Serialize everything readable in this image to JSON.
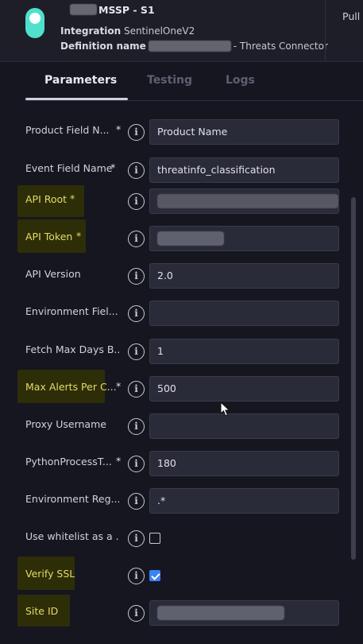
{
  "header": {
    "title": "MSSP - S1",
    "integration_label": "Integration",
    "integration_value": "SentinelOneV2",
    "definition_label": "Definition name",
    "definition_value": "- Threats Connector",
    "pull_label": "Pull"
  },
  "tabs": [
    {
      "label": "Parameters",
      "active": true
    },
    {
      "label": "Testing",
      "active": false
    },
    {
      "label": "Logs",
      "active": false
    }
  ],
  "params": [
    {
      "label": "Product Field N...",
      "required": true,
      "highlighted": false,
      "type": "text",
      "value": "Product Name"
    },
    {
      "label": "Event Field Name",
      "required": true,
      "highlighted": false,
      "type": "text",
      "value": "threatinfo_classification"
    },
    {
      "label": "API Root",
      "required": true,
      "highlighted": true,
      "type": "redacted",
      "value": ""
    },
    {
      "label": "API Token",
      "required": true,
      "highlighted": true,
      "type": "redacted",
      "value": ""
    },
    {
      "label": "API Version",
      "required": false,
      "highlighted": false,
      "type": "text",
      "value": "2.0"
    },
    {
      "label": "Environment Fiel...",
      "required": false,
      "highlighted": false,
      "type": "text",
      "value": ""
    },
    {
      "label": "Fetch Max Days B...",
      "required": false,
      "highlighted": false,
      "type": "text",
      "value": "1"
    },
    {
      "label": "Max Alerts Per C...",
      "required": true,
      "highlighted": true,
      "type": "text",
      "value": "500"
    },
    {
      "label": "Proxy Username",
      "required": false,
      "highlighted": false,
      "type": "text",
      "value": ""
    },
    {
      "label": "PythonProcessT...",
      "required": true,
      "highlighted": false,
      "type": "text",
      "value": "180"
    },
    {
      "label": "Environment Reg...",
      "required": false,
      "highlighted": false,
      "type": "text",
      "value": ".*"
    },
    {
      "label": "Use whitelist as a ...",
      "required": false,
      "highlighted": false,
      "type": "checkbox",
      "checked": false
    },
    {
      "label": "Verify SSL",
      "required": false,
      "highlighted": true,
      "type": "checkbox",
      "checked": true
    },
    {
      "label": "Site ID",
      "required": false,
      "highlighted": true,
      "type": "redacted",
      "value": ""
    }
  ],
  "icons": {
    "toggle": "toggle-icon",
    "info": "info-icon",
    "cursor": "mouse-pointer-icon"
  },
  "colors": {
    "background": "#161621",
    "header_bg": "#1d1e28",
    "toggle_accent": "#4fe1cc",
    "highlight_bg": "#2d2e07",
    "highlight_text": "#e4da6a",
    "checkbox_checked": "#3b82f6",
    "input_bg": "#2a2b38"
  }
}
